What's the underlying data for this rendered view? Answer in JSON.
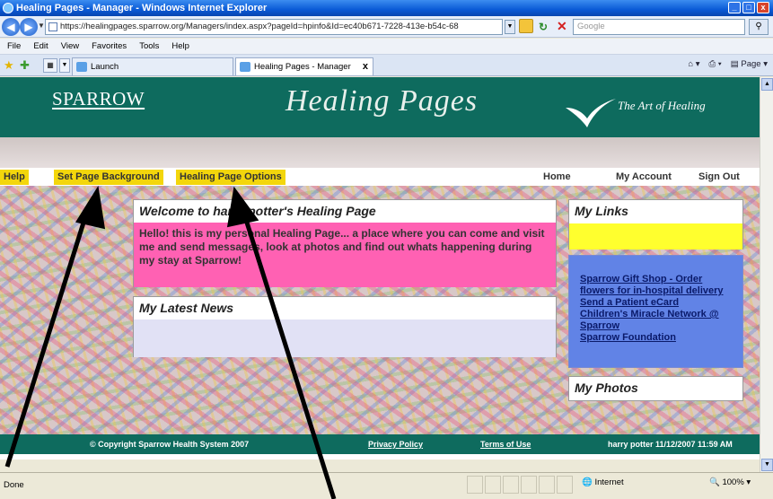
{
  "window": {
    "title": "Healing Pages - Manager - Windows Internet Explorer",
    "controls": [
      "_",
      "□",
      "x"
    ]
  },
  "address": {
    "url": "https://healingpages.sparrow.org/Managers/index.aspx?pageId=hpinfo&Id=ec40b671-7228-413e-b54c-68",
    "search_placeholder": "Google"
  },
  "menu": [
    "File",
    "Edit",
    "View",
    "Favorites",
    "Tools",
    "Help"
  ],
  "tabs": [
    {
      "label": "Launch",
      "active": false
    },
    {
      "label": "Healing Pages - Manager",
      "active": true
    }
  ],
  "toolbar": {
    "page_label": "Page"
  },
  "site": {
    "logo_sparrow": "SPARROW",
    "logo_healing": "Healing Pages",
    "logo_art": "The Art of Healing",
    "nav_buttons": [
      "Help",
      "Set Page Background",
      "Healing Page Options"
    ],
    "nav_links": [
      "Home",
      "My Account",
      "Sign Out"
    ]
  },
  "welcome": {
    "title": "Welcome to harry potter's Healing Page",
    "message": "Hello!  this is my personal Healing Page... a place where you can come and visit me and send messages, look at photos and find out whats happening during my stay at Sparrow!"
  },
  "news": {
    "title": "My Latest News"
  },
  "links": {
    "title": "My Links",
    "items": [
      "Sparrow Gift Shop - Order flowers for in-hospital delivery",
      "Send a Patient eCard",
      "Children's Miracle Network @ Sparrow",
      "Sparrow Foundation"
    ]
  },
  "photos": {
    "title": "My Photos"
  },
  "footer": {
    "copyright": "© Copyright Sparrow Health System 2007",
    "privacy": "Privacy Policy",
    "terms": "Terms of Use",
    "user_stamp": "harry potter 11/12/2007 11:59 AM"
  },
  "status": {
    "text": "Done",
    "zone": "Internet",
    "zoom": "100%"
  },
  "colors": {
    "brand_teal": "#0e6b5e",
    "nav_yellow": "#f3d60c",
    "welcome_pink": "#ff61b3",
    "links_blue": "#6183e6"
  }
}
